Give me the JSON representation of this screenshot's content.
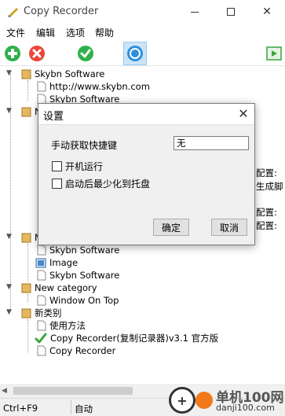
{
  "window": {
    "title": "Copy Recorder"
  },
  "menu": {
    "items": [
      "文件",
      "编辑",
      "选项",
      "帮助"
    ]
  },
  "toolbar": {
    "buttons": [
      {
        "name": "add-icon",
        "color": "#2fb14a"
      },
      {
        "name": "delete-icon",
        "color": "#e8483c"
      },
      {
        "name": "check-icon",
        "color": "#2fb14a"
      },
      {
        "name": "record-icon",
        "color": "#2e8fdc"
      },
      {
        "name": "play-icon",
        "color": "#3aa53a"
      }
    ]
  },
  "tree": {
    "rows": [
      {
        "label": "Skybn Software",
        "icon": "folder-icon"
      },
      {
        "label": "http://www.skybn.com",
        "icon": "document-icon"
      },
      {
        "label": "Skybn Software",
        "icon": "document-icon"
      },
      {
        "label": "N",
        "icon": "folder-icon"
      },
      {
        "label": "N",
        "icon": "folder-icon"
      },
      {
        "label": "Skybn Software",
        "icon": "document-icon"
      },
      {
        "label": "Image",
        "icon": "image-icon"
      },
      {
        "label": "Skybn Software",
        "icon": "document-icon"
      },
      {
        "label": "New category",
        "icon": "folder-icon"
      },
      {
        "label": "Window On Top",
        "icon": "document-icon"
      },
      {
        "label": "新类别",
        "icon": "folder-icon"
      },
      {
        "label": "使用方法",
        "icon": "document-icon"
      },
      {
        "label": "Copy Recorder(复制记录器)v3.1 官方版",
        "icon": "checkmark-icon"
      },
      {
        "label": "Copy Recorder",
        "icon": "document-icon"
      }
    ],
    "clipped_fragments": [
      "配置:",
      "生成脚",
      "配置:",
      "配置:"
    ]
  },
  "status": {
    "shortcut": "Ctrl+F9",
    "mode": "自动"
  },
  "watermark": {
    "name": "单机100网",
    "url": "danji100.com"
  },
  "dialog": {
    "title": "设置",
    "hotkey_label": "手动获取快捷键",
    "hotkey_value": "无",
    "startup_label": "开机运行",
    "minimize_label": "启动后最少化到托盘",
    "ok_label": "确定",
    "cancel_label": "取消"
  }
}
